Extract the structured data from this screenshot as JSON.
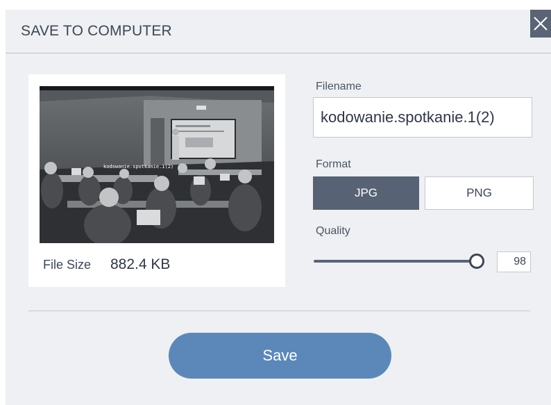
{
  "dialog": {
    "title": "SAVE TO COMPUTER",
    "close_icon": "close-icon"
  },
  "preview": {
    "image_description_icon": "classroom-photo",
    "image_caption": "kodowanie.spotkanie.1(2)",
    "filesize_label": "File Size",
    "filesize_value": "882.4 KB"
  },
  "filename": {
    "label": "Filename",
    "value": "kodowanie.spotkanie.1(2)"
  },
  "format": {
    "label": "Format",
    "options": [
      "JPG",
      "PNG"
    ],
    "selected": "JPG"
  },
  "quality": {
    "label": "Quality",
    "value": "98",
    "level_percent": 98
  },
  "actions": {
    "save_label": "Save"
  },
  "colors": {
    "background": "#eef0f3",
    "selected_format": "#576274",
    "save_button": "#5b88b8",
    "title_text": "#3d4654"
  }
}
